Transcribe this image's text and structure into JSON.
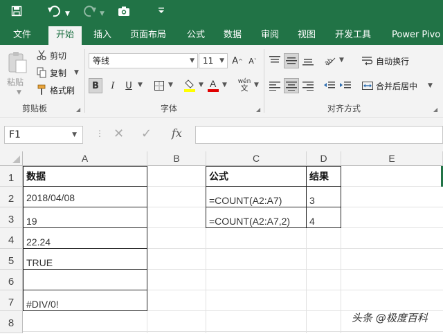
{
  "quick_access": {
    "save_icon": "save-icon",
    "undo_icon": "undo-icon",
    "redo_icon": "redo-icon",
    "camera_icon": "camera-icon"
  },
  "tabs": [
    "文件",
    "开始",
    "插入",
    "页面布局",
    "公式",
    "数据",
    "审阅",
    "视图",
    "开发工具",
    "Power Pivo"
  ],
  "active_tab": "开始",
  "ribbon": {
    "clipboard": {
      "paste": "粘贴",
      "cut": "剪切",
      "copy": "复制",
      "format_painter": "格式刷",
      "label": "剪贴板"
    },
    "font": {
      "name": "等线",
      "size": "11",
      "label": "字体",
      "bold": "B",
      "italic": "I",
      "underline": "U",
      "phonetic": "wén"
    },
    "alignment": {
      "wrap_text": "自动换行",
      "merge_center": "合并后居中",
      "label": "对齐方式"
    }
  },
  "formula_bar": {
    "name_box": "F1",
    "fx": "fx",
    "formula": ""
  },
  "columns": [
    "A",
    "B",
    "C",
    "D",
    "E"
  ],
  "rows": [
    "1",
    "2",
    "3",
    "4",
    "5",
    "6",
    "7",
    "8"
  ],
  "cells": {
    "A1": "数据",
    "A2": "2018/04/08",
    "A3": "19",
    "A4": "22.24",
    "A5": "TRUE",
    "A6": "",
    "A7": "#DIV/0!",
    "C1": "公式",
    "C2": "=COUNT(A2:A7)",
    "C3": "=COUNT(A2:A7,2)",
    "D1": "结果",
    "D2": "3",
    "D3": "4"
  },
  "colors": {
    "excel_green": "#217346",
    "ribbon_bg": "#f3f3f3",
    "highlight_yellow": "#ffff00",
    "font_red": "#e00000"
  },
  "watermark": "头条 @极度百科"
}
